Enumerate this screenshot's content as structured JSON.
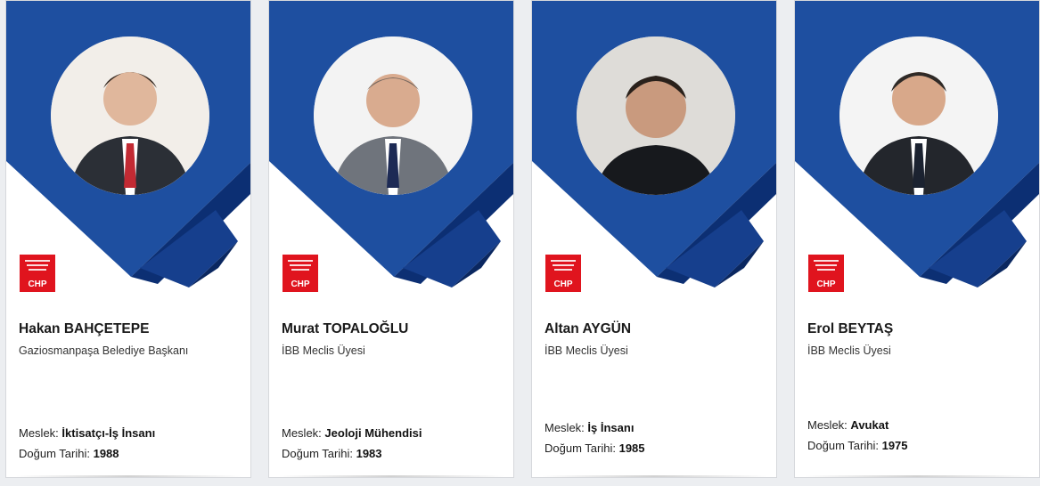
{
  "colors": {
    "primary_blue": "#1e4fa0",
    "dark_blue": "#0c2f73",
    "logo_red": "#e0141e"
  },
  "labels": {
    "occupation": "Meslek:",
    "birth_date": "Doğum Tarihi:"
  },
  "logo_text": "CHP",
  "cards": [
    {
      "name": "Hakan BAHÇETEPE",
      "title": "Gaziosmanpaşa Belediye Başkanı",
      "occupation": "İktisatçı-İş İnsanı",
      "birth_year": "1988",
      "icon": "person-photo"
    },
    {
      "name": "Murat TOPALOĞLU",
      "title": "İBB Meclis Üyesi",
      "occupation": "Jeoloji Mühendisi",
      "birth_year": "1983",
      "icon": "person-photo"
    },
    {
      "name": "Altan AYGÜN",
      "title": "İBB Meclis Üyesi",
      "occupation": "İş İnsanı",
      "birth_year": "1985",
      "icon": "person-photo"
    },
    {
      "name": "Erol BEYTAŞ",
      "title": "İBB Meclis Üyesi",
      "occupation": "Avukat",
      "birth_year": "1975",
      "icon": "person-photo"
    }
  ]
}
